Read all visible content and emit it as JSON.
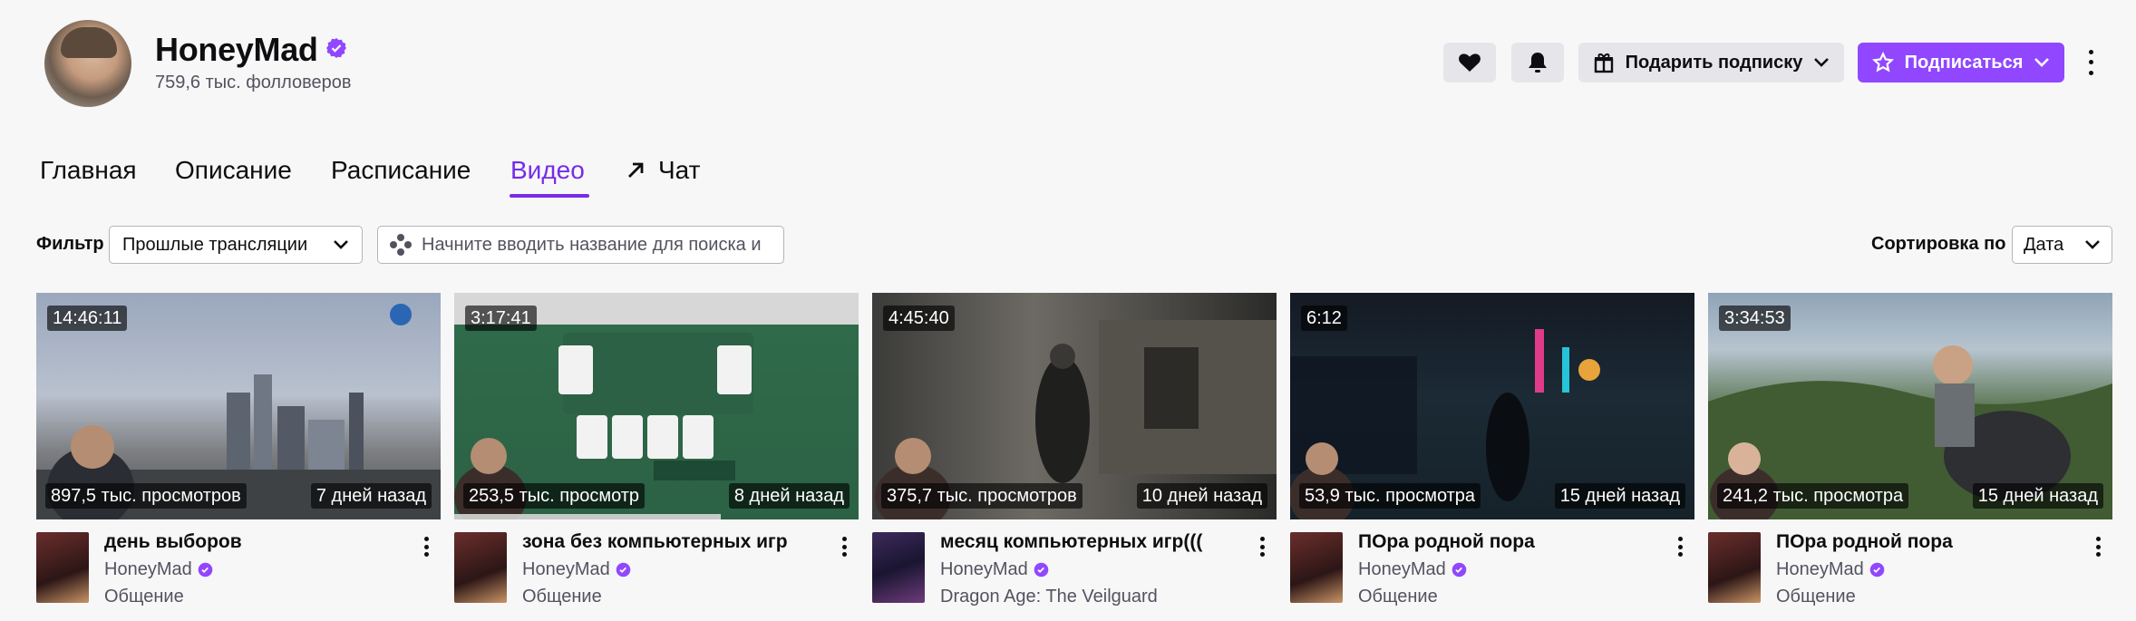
{
  "channel": {
    "name": "HoneyMad",
    "followers": "759,6 тыс. фолловеров"
  },
  "header_actions": {
    "gift_label": "Подарить подписку",
    "subscribe_label": "Подписаться"
  },
  "colors": {
    "accent": "#9147ff",
    "active_tab": "#772ce8"
  },
  "tabs": [
    {
      "label": "Главная",
      "active": false
    },
    {
      "label": "Описание",
      "active": false
    },
    {
      "label": "Расписание",
      "active": false
    },
    {
      "label": "Видео",
      "active": true
    },
    {
      "label": "Чат",
      "active": false,
      "icon": "external-arrow-icon"
    }
  ],
  "filters": {
    "filter_label": "Фильтр",
    "filter_value": "Прошлые трансляции",
    "search_placeholder": "Начните вводить название для поиска и",
    "sort_label": "Сортировка по",
    "sort_value": "Дата"
  },
  "videos": [
    {
      "duration": "14:46:11",
      "views": "897,5 тыс. просмотров",
      "age": "7 дней назад",
      "title": "день выборов",
      "channel": "HoneyMad",
      "category": "Общение"
    },
    {
      "duration": "3:17:41",
      "views": "253,5 тыс. просмотр",
      "age": "8 дней назад",
      "title": "зона без компьютерных игр",
      "channel": "HoneyMad",
      "category": "Общение",
      "watch_progress": 0.66
    },
    {
      "duration": "4:45:40",
      "views": "375,7 тыс. просмотров",
      "age": "10 дней назад",
      "title": "месяц компьютерных игр(((",
      "channel": "HoneyMad",
      "category": "Dragon Age: The Veilguard"
    },
    {
      "duration": "6:12",
      "views": "53,9 тыс. просмотра",
      "age": "15 дней назад",
      "title": "ПОра родной пора",
      "channel": "HoneyMad",
      "category": "Общение"
    },
    {
      "duration": "3:34:53",
      "views": "241,2 тыс. просмотра",
      "age": "15 дней назад",
      "title": "ПОра родной пора",
      "channel": "HoneyMad",
      "category": "Общение"
    }
  ]
}
